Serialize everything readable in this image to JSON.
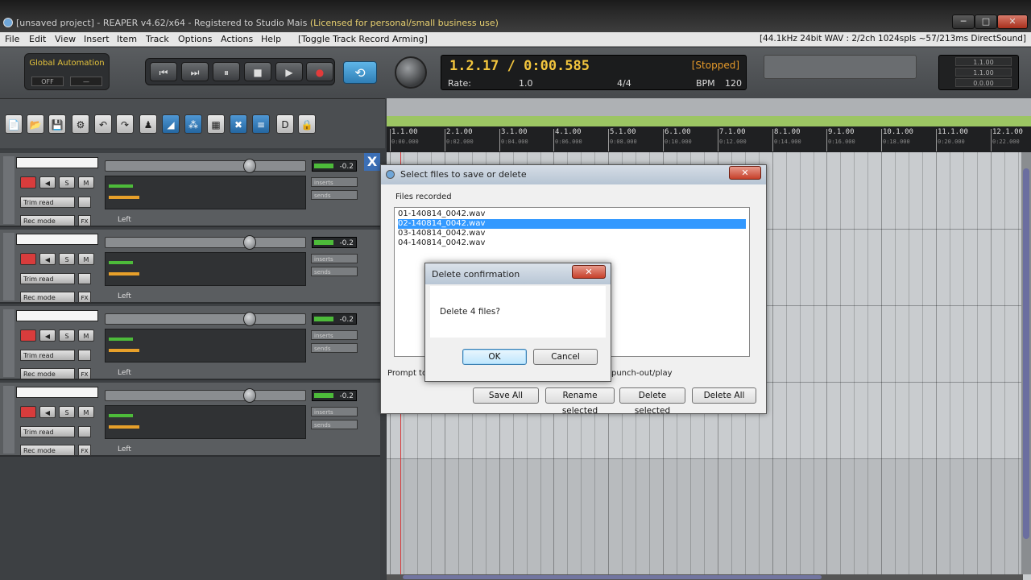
{
  "window": {
    "title_main": "[unsaved project] - REAPER v4.62/x64 - Registered to Studio Mais",
    "title_license": "(Licensed for personal/small business use)",
    "minimize": "─",
    "maximize": "□",
    "close": "✕"
  },
  "menu": {
    "items": [
      "File",
      "Edit",
      "View",
      "Insert",
      "Item",
      "Track",
      "Options",
      "Actions",
      "Help"
    ],
    "last_action": "[Toggle Track Record Arming]",
    "audio_status": "[44.1kHz 24bit WAV : 2/2ch 1024spls ~57/213ms DirectSound]"
  },
  "transport": {
    "global_automation_label": "Global Automation",
    "global_automation_value": "OFF",
    "global_automation_dash": "—",
    "buttons": [
      "⏮",
      "⏭",
      "⏸",
      "■",
      "▶",
      "●"
    ],
    "loop_icon": "⟲",
    "time_position": "1.2.17 / 0:00.585",
    "state": "[Stopped]",
    "rate_label": "Rate:",
    "rate_value": "1.0",
    "time_signature": "4/4",
    "bpm_label": "BPM",
    "bpm_value": "120",
    "meter_values": [
      "1.1.00",
      "1.1.00",
      "0.0.00"
    ]
  },
  "toolbar": {
    "icons": [
      "📄",
      "📂",
      "💾",
      "⚙",
      "↶",
      "↷",
      "♟",
      "◢",
      "⁂",
      "▦",
      "✖",
      "≡",
      "D",
      "🔒"
    ]
  },
  "tracks": [
    {
      "peak": "-0.2",
      "trim": "Trim read",
      "recmode": "Rec mode",
      "pan": "Left",
      "fx1": "inserts",
      "fx2": "sends"
    },
    {
      "peak": "-0.2",
      "trim": "Trim read",
      "recmode": "Rec mode",
      "pan": "Left",
      "fx1": "inserts",
      "fx2": "sends"
    },
    {
      "peak": "-0.2",
      "trim": "Trim read",
      "recmode": "Rec mode",
      "pan": "Left",
      "fx1": "inserts",
      "fx2": "sends"
    },
    {
      "peak": "-0.2",
      "trim": "Trim read",
      "recmode": "Rec mode",
      "pan": "Left",
      "fx1": "inserts",
      "fx2": "sends"
    }
  ],
  "track_buttons": {
    "mute": "◀",
    "solo": "S",
    "phase": "M",
    "fx": "FX"
  },
  "mixer_close": "X",
  "ruler": [
    {
      "bar": "1.1.00",
      "time": "0:00.000"
    },
    {
      "bar": "2.1.00",
      "time": "0:02.000"
    },
    {
      "bar": "3.1.00",
      "time": "0:04.000"
    },
    {
      "bar": "4.1.00",
      "time": "0:06.000"
    },
    {
      "bar": "5.1.00",
      "time": "0:08.000"
    },
    {
      "bar": "6.1.00",
      "time": "0:10.000"
    },
    {
      "bar": "7.1.00",
      "time": "0:12.000"
    },
    {
      "bar": "8.1.00",
      "time": "0:14.000"
    },
    {
      "bar": "9.1.00",
      "time": "0:16.000"
    },
    {
      "bar": "10.1.00",
      "time": "0:18.000"
    },
    {
      "bar": "11.1.00",
      "time": "0:20.000"
    },
    {
      "bar": "12.1.00",
      "time": "0:22.000"
    }
  ],
  "files_dialog": {
    "title": "Select files to save or delete",
    "close": "✕",
    "label": "Files recorded",
    "files": [
      "01-140814_0042.wav",
      "02-140814_0042.wav",
      "03-140814_0042.wav",
      "04-140814_0042.wav"
    ],
    "selected_index": 1,
    "prompt_left": "Prompt to s",
    "prompt_right": "punch-out/play",
    "buttons": {
      "save_all": "Save All",
      "rename_selected": "Rename selected",
      "delete_selected": "Delete selected",
      "delete_all": "Delete All"
    }
  },
  "confirm_dialog": {
    "title": "Delete confirmation",
    "close": "✕",
    "message": "Delete 4 files?",
    "ok": "OK",
    "cancel": "Cancel"
  }
}
